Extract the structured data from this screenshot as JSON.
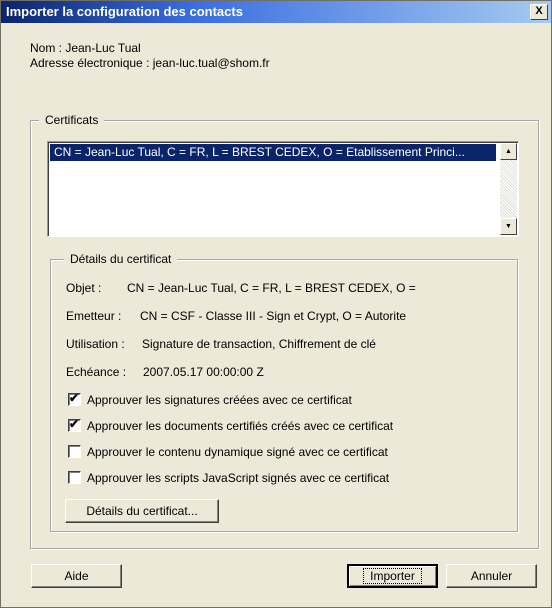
{
  "window": {
    "title": "Importer la configuration des contacts",
    "close_label": "X"
  },
  "contact": {
    "name": "Nom : Jean-Luc Tual",
    "email": "Adresse électronique : jean-luc.tual@shom.fr"
  },
  "certificates": {
    "legend": "Certificats",
    "items": [
      "CN = Jean-Luc Tual, C = FR, L = BREST CEDEX, O = Etablissement Princi..."
    ]
  },
  "details": {
    "legend": "Détails du certificat",
    "objet_label": "Objet :",
    "objet_value": "CN = Jean-Luc Tual, C = FR, L = BREST CEDEX, O =",
    "emetteur_label": "Emetteur :",
    "emetteur_value": "CN = CSF - Classe III - Sign et Crypt, O = Autorite",
    "utilisation_label": "Utilisation :",
    "utilisation_value": "Signature de transaction, Chiffrement de clé",
    "echeance_label": "Echéance :",
    "echeance_value": "2007.05.17 00:00:00 Z",
    "checks": [
      {
        "label": "Approuver les signatures créées avec ce certificat",
        "checked": true
      },
      {
        "label": "Approuver les documents certifiés créés avec ce certificat",
        "checked": true
      },
      {
        "label": "Approuver le contenu  dynamique signé avec ce certificat",
        "checked": false
      },
      {
        "label": "Approuver les scripts JavaScript signés avec ce certificat",
        "checked": false
      }
    ],
    "details_button": "Détails du certificat..."
  },
  "buttons": {
    "help": "Aide",
    "import": "Importer",
    "cancel": "Annuler"
  }
}
